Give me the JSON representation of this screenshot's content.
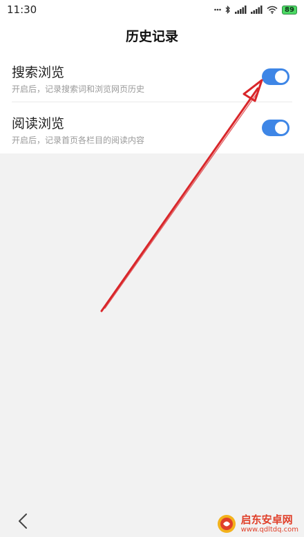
{
  "status_bar": {
    "time": "11:30",
    "icons": [
      "dots-icon",
      "bluetooth-icon",
      "signal-icon",
      "signal-icon",
      "wifi-icon"
    ],
    "battery": "89"
  },
  "header": {
    "title": "历史记录"
  },
  "settings": [
    {
      "label": "搜索浏览",
      "description": "开启后，记录搜索词和浏览网页历史",
      "enabled": true
    },
    {
      "label": "阅读浏览",
      "description": "开启后，记录首页各栏目的阅读内容",
      "enabled": true
    }
  ],
  "colors": {
    "accent": "#3e86e6",
    "annotation_arrow": "#d9262a",
    "watermark": "#e0402a"
  },
  "watermark": {
    "name": "启东安卓网",
    "url": "www.qdltdq.com"
  }
}
